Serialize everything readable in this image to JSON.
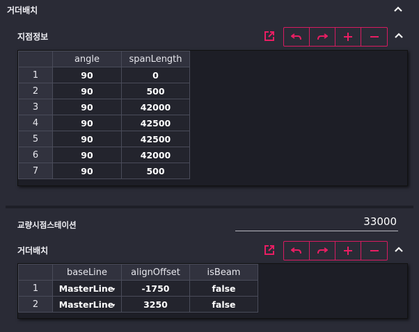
{
  "header": {
    "title": "거더배치"
  },
  "support": {
    "title": "지점정보",
    "columns": [
      "angle",
      "spanLength"
    ],
    "rows": [
      {
        "idx": "1",
        "angle": "90",
        "span": "0"
      },
      {
        "idx": "2",
        "angle": "90",
        "span": "500"
      },
      {
        "idx": "3",
        "angle": "90",
        "span": "42000"
      },
      {
        "idx": "4",
        "angle": "90",
        "span": "42500"
      },
      {
        "idx": "5",
        "angle": "90",
        "span": "42500"
      },
      {
        "idx": "6",
        "angle": "90",
        "span": "42000"
      },
      {
        "idx": "7",
        "angle": "90",
        "span": "500"
      }
    ]
  },
  "station": {
    "label": "교량시점스테이션",
    "value": "33000"
  },
  "girder": {
    "title": "거더배치",
    "columns": [
      "baseLine",
      "alignOffset",
      "isBeam"
    ],
    "rows": [
      {
        "idx": "1",
        "baseLine": "MasterLine",
        "offset": "-1750",
        "isBeam": "false"
      },
      {
        "idx": "2",
        "baseLine": "MasterLine",
        "offset": "3250",
        "isBeam": "false"
      }
    ]
  },
  "colors": {
    "accent": "#e91e63",
    "background": "#2a2b36",
    "grid": "#1d1e26"
  },
  "icons": [
    "chevron-up-icon",
    "external-link-icon",
    "undo-icon",
    "redo-icon",
    "plus-icon",
    "minus-icon"
  ]
}
